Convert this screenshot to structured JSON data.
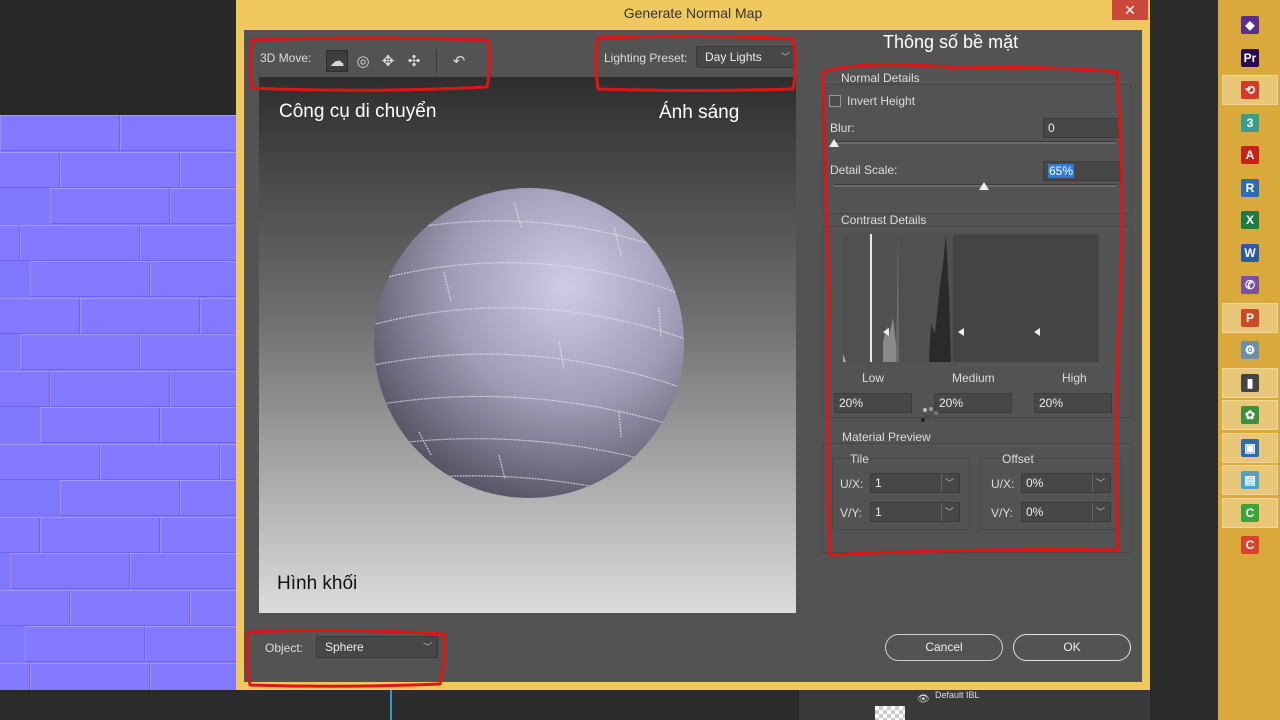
{
  "dialog": {
    "title": "Generate Normal Map",
    "close_symbol": "✕",
    "toolbar": {
      "move_label": "3D Move:",
      "tools": [
        {
          "name": "orbit-3d-camera-icon",
          "glyph": "☁"
        },
        {
          "name": "roll-3d-camera-icon",
          "glyph": "◎"
        },
        {
          "name": "pan-3d-camera-icon",
          "glyph": "✥"
        },
        {
          "name": "slide-3d-camera-icon",
          "glyph": "✣"
        },
        {
          "name": "reset-view-icon",
          "glyph": "↶"
        }
      ],
      "lighting_label": "Lighting Preset:",
      "lighting_value": "Day Lights"
    },
    "object_label": "Object:",
    "object_value": "Sphere",
    "panel": {
      "normal_details": {
        "title": "Normal Details",
        "invert_height_label": "Invert Height",
        "invert_height_checked": false,
        "blur_label": "Blur:",
        "blur_value": "0",
        "blur_level": 0,
        "detail_scale_label": "Detail Scale:",
        "detail_scale_value": "65%",
        "detail_scale_level": 0.65
      },
      "contrast_details": {
        "title": "Contrast Details",
        "low_label": "Low",
        "medium_label": "Medium",
        "high_label": "High",
        "low_value": "20%",
        "medium_value": "20%",
        "high_value": "20%"
      },
      "material_preview": {
        "title": "Material Preview",
        "tile_label": "Tile",
        "offset_label": "Offset",
        "ux_label": "U/X:",
        "vy_label": "V/Y:",
        "tile_ux": "1",
        "tile_vy": "1",
        "offset_ux": "0%",
        "offset_vy": "0%"
      }
    },
    "cancel_label": "Cancel",
    "ok_label": "OK"
  },
  "annotations": {
    "move_tools": "Công cụ di chuyển",
    "lighting": "Ánh sáng",
    "surface_params": "Thông số bề mặt",
    "shape": "Hình khối"
  },
  "layers_panel": {
    "eye_symbol": "👁",
    "layer_name": "Default IBL"
  },
  "dock": {
    "items": [
      {
        "name": "dock-app-vs-icon",
        "glyph": "◆",
        "color": "#5c2d91"
      },
      {
        "name": "dock-app-premiere-icon",
        "glyph": "Pr",
        "color": "#2a0b4d"
      },
      {
        "name": "dock-app-pdf-icon",
        "glyph": "⟲",
        "color": "#d23a2a"
      },
      {
        "name": "dock-app-3-icon",
        "glyph": "3",
        "color": "#3a9c8f"
      },
      {
        "name": "dock-app-acrobat-icon",
        "glyph": "A",
        "color": "#c8201b"
      },
      {
        "name": "dock-app-r-icon",
        "glyph": "R",
        "color": "#2d6bb5"
      },
      {
        "name": "dock-app-excel-icon",
        "glyph": "X",
        "color": "#1f7a43"
      },
      {
        "name": "dock-app-word-icon",
        "glyph": "W",
        "color": "#2b5aa8"
      },
      {
        "name": "dock-app-viber-icon",
        "glyph": "✆",
        "color": "#7b519d"
      },
      {
        "name": "dock-app-powerpoint-icon",
        "glyph": "P",
        "color": "#c94a24"
      },
      {
        "name": "dock-app-tool-icon",
        "glyph": "⚙",
        "color": "#6b8fa8"
      },
      {
        "name": "dock-app-phone-icon",
        "glyph": "▮",
        "color": "#444444"
      },
      {
        "name": "dock-app-paint-icon",
        "glyph": "✿",
        "color": "#3f8f3f"
      },
      {
        "name": "dock-app-photos-icon",
        "glyph": "▣",
        "color": "#2d6bb5"
      },
      {
        "name": "dock-app-notes-icon",
        "glyph": "▤",
        "color": "#4aa3c9"
      },
      {
        "name": "dock-app-camtasia-icon",
        "glyph": "C",
        "color": "#3aa43a"
      },
      {
        "name": "dock-app-camtasia-red-icon",
        "glyph": "C",
        "color": "#d9422b"
      }
    ]
  }
}
